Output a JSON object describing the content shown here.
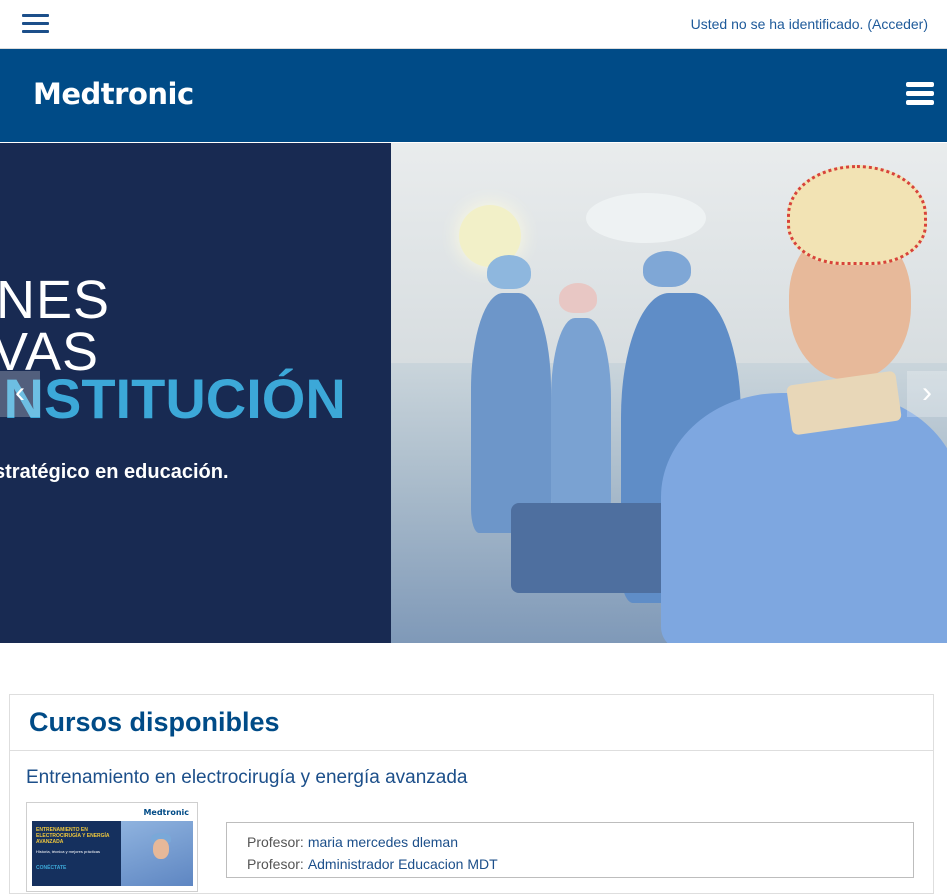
{
  "topbar": {
    "login_text": "Usted no se ha identificado.",
    "login_link": "(Acceder)"
  },
  "brand": {
    "logo_text": "Medtronic"
  },
  "slider": {
    "line1": "NES",
    "line2": "VAS",
    "line3": "INSTITUCIÓN",
    "line4": "stratégico en educación.",
    "prev_arrow": "‹",
    "next_arrow": "›"
  },
  "courses": {
    "title": "Cursos disponibles",
    "items": [
      {
        "name": "Entrenamiento en electrocirugía y energía avanzada",
        "thumbnail": {
          "logo": "Medtronic",
          "heading": "ENTRENAMIENTO EN ELECTROCIRUGÍA Y ENERGÍA AVANZADA",
          "subtitle": "Historia, técnica y mejores prácticas",
          "cta": "CONÉCTATE"
        },
        "teachers": [
          {
            "label": "Profesor:",
            "name": "maria mercedes dleman"
          },
          {
            "label": "Profesor:",
            "name": "Administrador Educacion MDT"
          }
        ]
      }
    ]
  },
  "colors": {
    "brand_blue": "#004b87",
    "link_blue": "#1c4f8a",
    "slide_navy": "#182a52",
    "slide_accent": "#3ca8d8"
  },
  "icons": {
    "topbar_menu": "hamburger-icon",
    "brand_menu": "hamburger-icon",
    "prev": "chevron-left-icon",
    "next": "chevron-right-icon"
  }
}
